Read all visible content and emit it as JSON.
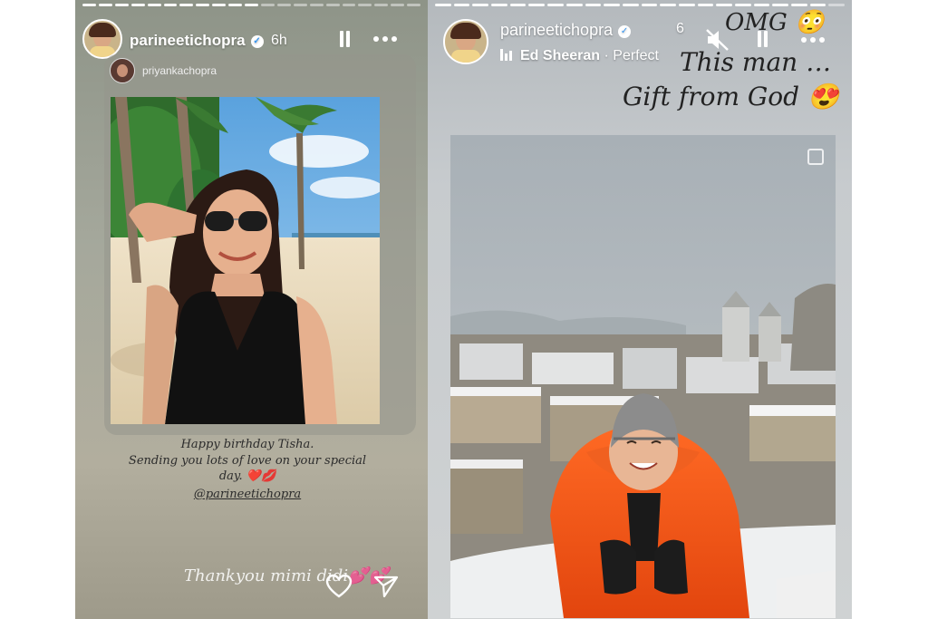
{
  "story1": {
    "username": "parineetichopra",
    "time": "6h",
    "reshared": {
      "username": "priyankachopra",
      "caption_line1": "Happy birthday Tisha.",
      "caption_line2": "Sending you lots of love on your special",
      "caption_line3": "day. ❤️💋",
      "mention": "@parineetichopra"
    },
    "reply_text": "Thankyou mimi didi💕💕",
    "icons": [
      "verified-badge",
      "pause-icon",
      "more-options-icon",
      "heart-icon",
      "send-icon"
    ]
  },
  "story2": {
    "username": "parineetichopra",
    "time": "6",
    "music": {
      "artist": "Ed Sheeran",
      "song": "Perfect",
      "separator": "·"
    },
    "overlay_text": {
      "line1": "OMG 😳",
      "line2": "This man …",
      "line3": "Gift from God 😍"
    },
    "icons": [
      "verified-badge",
      "mute-icon",
      "pause-icon",
      "more-options-icon",
      "music-bars-icon"
    ]
  },
  "colors": {
    "story_text": "#ffffff",
    "instagram_blue": "#3897f0",
    "jacket": "#f05a1c",
    "heart": "#d4142a"
  }
}
